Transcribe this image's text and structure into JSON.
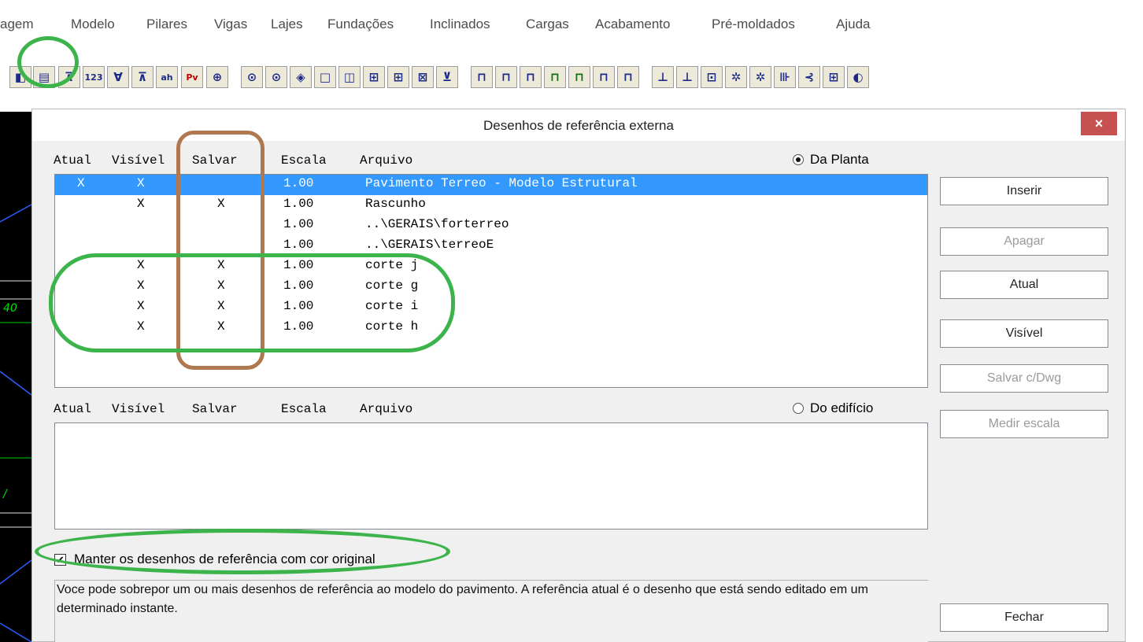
{
  "menu": [
    "agem",
    "Modelo",
    "Pilares",
    "Vigas",
    "Lajes",
    "Fundações",
    "Inclinados",
    "Cargas",
    "Acabamento",
    "Pré-moldados",
    "Ajuda"
  ],
  "toolbar": {
    "glyphs": [
      "◧",
      "▤",
      "⊼",
      "123",
      "∀",
      "⊼",
      "ah",
      "Pv",
      "⊕",
      "⊙",
      "⊙",
      "◈",
      "□",
      "◫",
      "⊞",
      "⊞",
      "⊠",
      "⊻",
      "⊓",
      "⊓",
      "⊓",
      "⊓",
      "⊓",
      "⊓",
      "⊓",
      "⊥",
      "⊥",
      "⊡",
      "✲",
      "✲",
      "⊪",
      "⊰",
      "⊞",
      "◐"
    ]
  },
  "cad": {
    "label_1": "40",
    "label_2": "/"
  },
  "dialog": {
    "title": "Desenhos de referência externa",
    "close": "×",
    "top_header": {
      "atual": "Atual",
      "visivel": "Visível",
      "salvar": "Salvar",
      "escala": "Escala",
      "arquivo": "Arquivo"
    },
    "radio_planta": "Da Planta",
    "radio_edificio": "Do edifício",
    "top_rows": [
      {
        "atual": "X",
        "visivel": "X",
        "salvar": "",
        "escala": "1.00",
        "arquivo": "Pavimento Terreo - Modelo Estrutural"
      },
      {
        "atual": "",
        "visivel": "X",
        "salvar": "X",
        "escala": "1.00",
        "arquivo": "Rascunho"
      },
      {
        "atual": "",
        "visivel": "",
        "salvar": "",
        "escala": "1.00",
        "arquivo": "..\\GERAIS\\forterreo"
      },
      {
        "atual": "",
        "visivel": "",
        "salvar": "",
        "escala": "1.00",
        "arquivo": "..\\GERAIS\\terreoE"
      },
      {
        "atual": "",
        "visivel": "X",
        "salvar": "X",
        "escala": "1.00",
        "arquivo": "corte j"
      },
      {
        "atual": "",
        "visivel": "X",
        "salvar": "X",
        "escala": "1.00",
        "arquivo": "corte g"
      },
      {
        "atual": "",
        "visivel": "X",
        "salvar": "X",
        "escala": "1.00",
        "arquivo": "corte i"
      },
      {
        "atual": "",
        "visivel": "X",
        "salvar": "X",
        "escala": "1.00",
        "arquivo": "corte h"
      }
    ],
    "bottom_header": {
      "atual": "Atual",
      "visivel": "Visível",
      "salvar": "Salvar",
      "escala": "Escala",
      "arquivo": "Arquivo"
    },
    "buttons": {
      "inserir": "Inserir",
      "apagar": "Apagar",
      "atual": "Atual",
      "visivel": "Visível",
      "salvar_dwg": "Salvar c/Dwg",
      "medir_escala": "Medir escala",
      "fechar": "Fechar"
    },
    "checkbox_label": "Manter os desenhos de referência com cor original",
    "checkbox_mark": "✔",
    "help": "Voce pode sobrepor um ou mais desenhos de referência ao modelo do pavimento. A referência atual é o desenho que está sendo editado em um determinado instante."
  },
  "colors": {
    "selection": "#3399ff",
    "annotation_green": "#3cb44b",
    "annotation_brown": "#b07850",
    "close_red": "#c75050"
  }
}
